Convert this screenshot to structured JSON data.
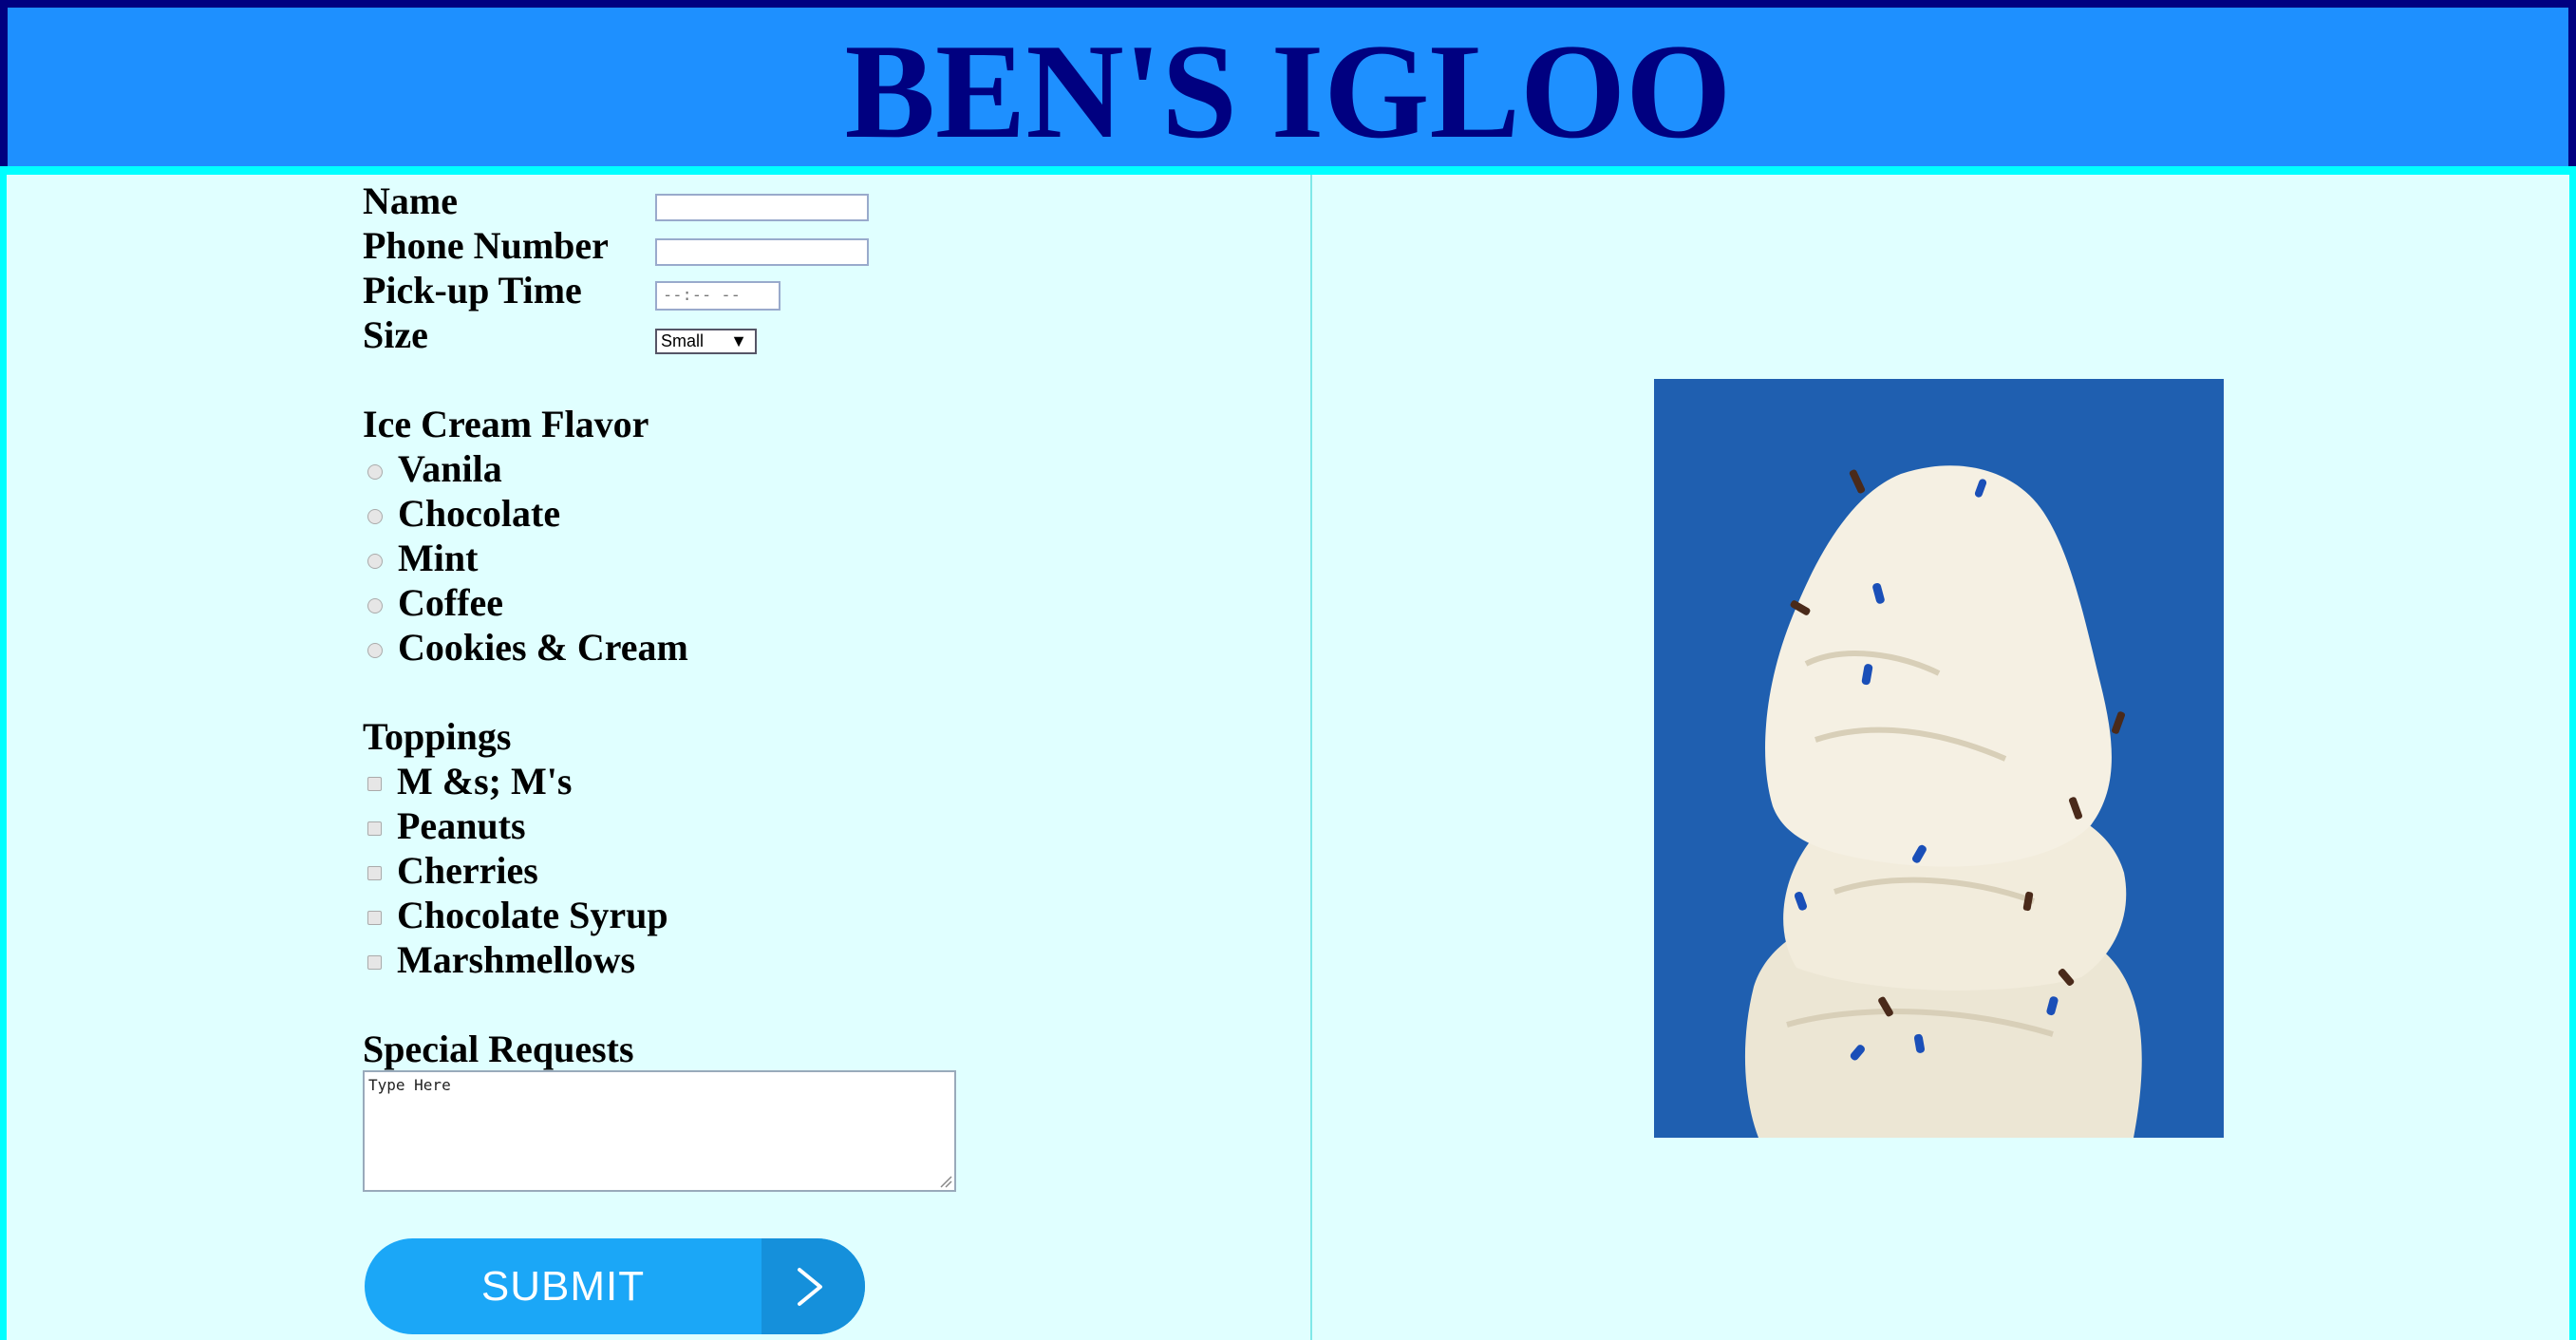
{
  "header": {
    "title": "BEN'S IGLOO"
  },
  "form": {
    "name_label": "Name",
    "phone_label": "Phone Number",
    "time_label": "Pick-up Time",
    "time_placeholder": "--:-- --",
    "size_label": "Size",
    "size_selected": "Small",
    "flavor_heading": "Ice Cream Flavor",
    "flavors": [
      "Vanila",
      "Chocolate",
      "Mint",
      "Coffee",
      "Cookies & Cream"
    ],
    "toppings_heading": "Toppings",
    "toppings": [
      "M &s; M's",
      "Peanuts",
      "Cherries",
      "Chocolate Syrup",
      "Marshmellows"
    ],
    "requests_heading": "Special Requests",
    "requests_value": "Type Here",
    "submit_label": "SUBMIT"
  },
  "icons": {
    "submit_arrow": "chevron-right-icon",
    "size_dropdown": "triangle-down-icon",
    "photo": "ice-cream-scoops-image"
  },
  "colors": {
    "header_bg": "#1e90ff",
    "header_text": "#000080",
    "page_bg": "#e0ffff",
    "accent_border": "#00ffff",
    "submit_bg": "#1ba7f7",
    "photo_bg": "#1f5fb0"
  }
}
